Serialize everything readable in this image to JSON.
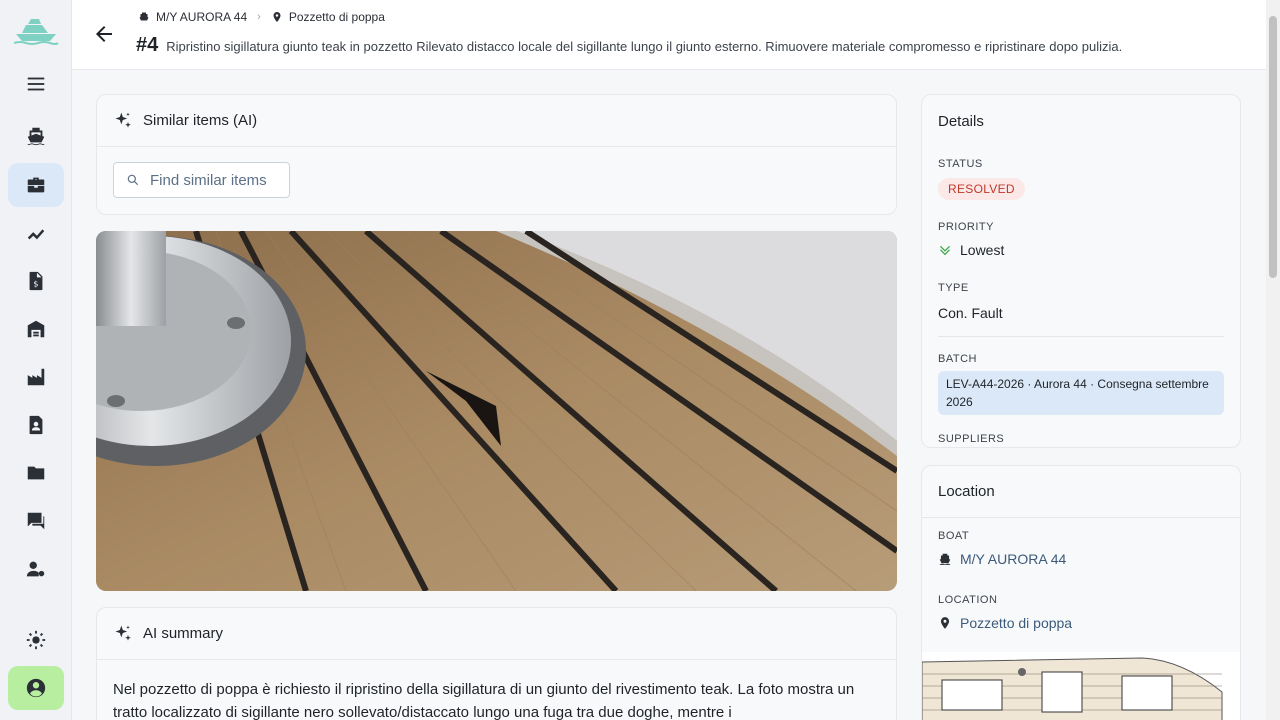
{
  "header": {
    "boat_crumb": "M/Y AURORA 44",
    "location_crumb": "Pozzetto di poppa",
    "issue_number": "#4",
    "issue_description": "Ripristino sigillatura giunto teak in pozzetto Rilevato distacco locale del sigillante lungo il giunto esterno. Rimuovere materiale compromesso e ripristinare dopo pulizia."
  },
  "similar": {
    "title": "Similar items (AI)",
    "button_label": "Find similar items"
  },
  "summary": {
    "title": "AI summary",
    "text": "Nel pozzetto di poppa è richiesto il ripristino della sigillatura di un giunto del rivestimento teak. La foto mostra un tratto localizzato di sigillante nero sollevato/distaccato lungo una fuga tra due doghe, mentre i"
  },
  "details": {
    "title": "Details",
    "status_label": "STATUS",
    "status_value": "RESOLVED",
    "priority_label": "PRIORITY",
    "priority_value": "Lowest",
    "type_label": "TYPE",
    "type_value": "Con. Fault",
    "batch_label": "BATCH",
    "batch_value": "LEV-A44-2026 · Aurora 44 · Consegna settembre 2026",
    "suppliers_label": "SUPPLIERS"
  },
  "location": {
    "title": "Location",
    "boat_label": "BOAT",
    "boat_value": "M/Y AURORA 44",
    "location_label": "LOCATION",
    "location_value": "Pozzetto di poppa"
  },
  "colors": {
    "status_bg": "#fde8e8",
    "status_text": "#c0392b",
    "priority_icon": "#3aa64a",
    "active_nav": "#dbe8f7",
    "user_nav": "#b8ee9f"
  }
}
